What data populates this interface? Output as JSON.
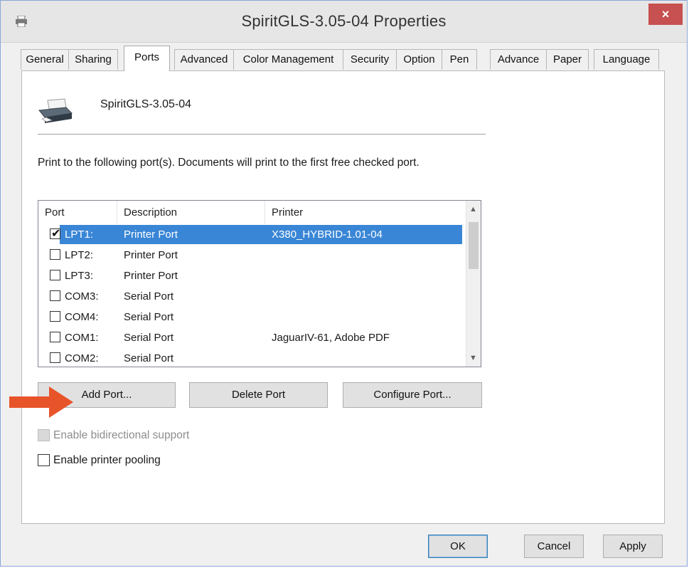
{
  "window": {
    "title": "SpiritGLS-3.05-04 Properties",
    "close_label": "×"
  },
  "tabs": [
    {
      "label": "General"
    },
    {
      "label": "Sharing"
    },
    {
      "label": "Ports",
      "active": true
    },
    {
      "label": "Advanced"
    },
    {
      "label": "Color Management"
    },
    {
      "label": "Security"
    },
    {
      "label": "Option"
    },
    {
      "label": "Pen"
    },
    {
      "label": "Advance"
    },
    {
      "label": "Paper"
    },
    {
      "label": "Language"
    }
  ],
  "ports_page": {
    "printer_name": "SpiritGLS-3.05-04",
    "instruction": "Print to the following port(s). Documents will print to the first free checked port.",
    "columns": {
      "port": "Port",
      "description": "Description",
      "printer": "Printer"
    },
    "rows": [
      {
        "port": "LPT1:",
        "description": "Printer Port",
        "printer": "X380_HYBRID-1.01-04",
        "checked": true,
        "selected": true
      },
      {
        "port": "LPT2:",
        "description": "Printer Port",
        "printer": "",
        "checked": false
      },
      {
        "port": "LPT3:",
        "description": "Printer Port",
        "printer": "",
        "checked": false
      },
      {
        "port": "COM3:",
        "description": "Serial Port",
        "printer": "",
        "checked": false
      },
      {
        "port": "COM4:",
        "description": "Serial Port",
        "printer": "",
        "checked": false
      },
      {
        "port": "COM1:",
        "description": "Serial Port",
        "printer": "JaguarIV-61, Adobe PDF",
        "checked": false
      },
      {
        "port": "COM2:",
        "description": "Serial Port",
        "printer": "",
        "checked": false
      }
    ],
    "buttons": {
      "add_port": "Add Port...",
      "delete_port": "Delete Port",
      "configure_port": "Configure Port..."
    },
    "options": {
      "bidirectional": "Enable bidirectional support",
      "pooling": "Enable printer pooling"
    }
  },
  "footer": {
    "ok": "OK",
    "cancel": "Cancel",
    "apply": "Apply"
  },
  "colors": {
    "selection": "#3a86d6",
    "close_button": "#c75050",
    "annotation_arrow": "#e8542a"
  }
}
